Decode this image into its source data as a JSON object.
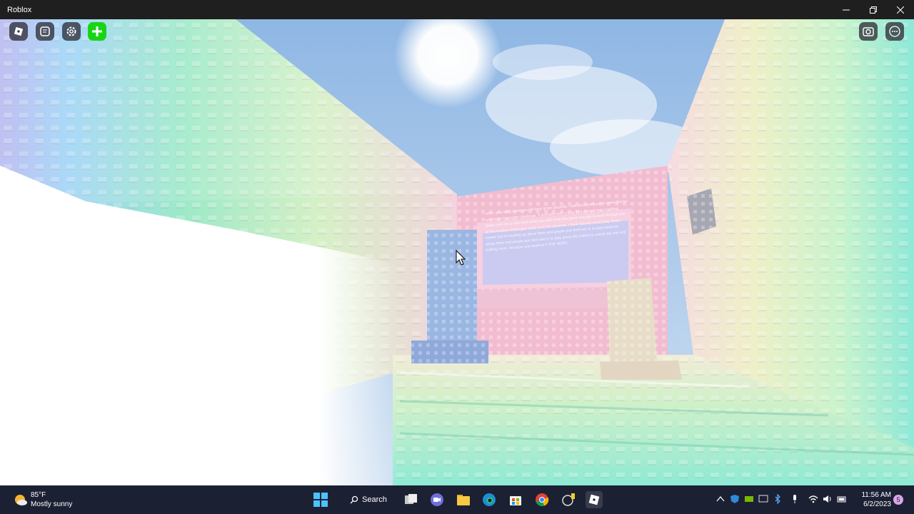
{
  "window": {
    "title": "Roblox",
    "controls": [
      "minimize",
      "restore",
      "close"
    ]
  },
  "hud": {
    "left_buttons": [
      "roblox-menu-icon",
      "chat-icon",
      "settings-gear-icon",
      "add-plus-icon"
    ],
    "right_buttons": [
      "screenshot-camera-icon",
      "more-options-icon"
    ]
  },
  "scene": {
    "sign_text": "wow.. you really want you left here in ten seconds. I did not expect you to come this far and make it past the challenge. It probably took a long time doing a soul crushing tower, you are a hard and some you ain't lovin this game enough to push through one of the hardest challenges early on in the universe. I think nobody would play these towers but im reading up about them and people just dont see it. to play hardcore about them and people just dont see it. to play press this button to unlock the rest and nothing more. because you deserve it THE MOST.",
    "colors": {
      "sky": "#a8c9ec",
      "pink_wall": "#f1b9cf",
      "mint_floor": "#a6ecd6",
      "blue_pillar": "#98b4e2",
      "beige_pillar": "#e8ddc8",
      "plus_button": "#1ed21e"
    }
  },
  "taskbar": {
    "weather": {
      "temp": "85°F",
      "condition": "Mostly sunny"
    },
    "search_label": "Search",
    "apps": [
      "windows-start-icon",
      "search-icon",
      "task-view-icon",
      "teams-chat-icon",
      "file-explorer-icon",
      "edge-icon",
      "microsoft-store-icon",
      "chrome-icon",
      "cheat-engine-icon",
      "roblox-icon"
    ],
    "clock": {
      "time": "11:56 AM",
      "date": "6/2/2023"
    },
    "notification_badge": "5"
  }
}
